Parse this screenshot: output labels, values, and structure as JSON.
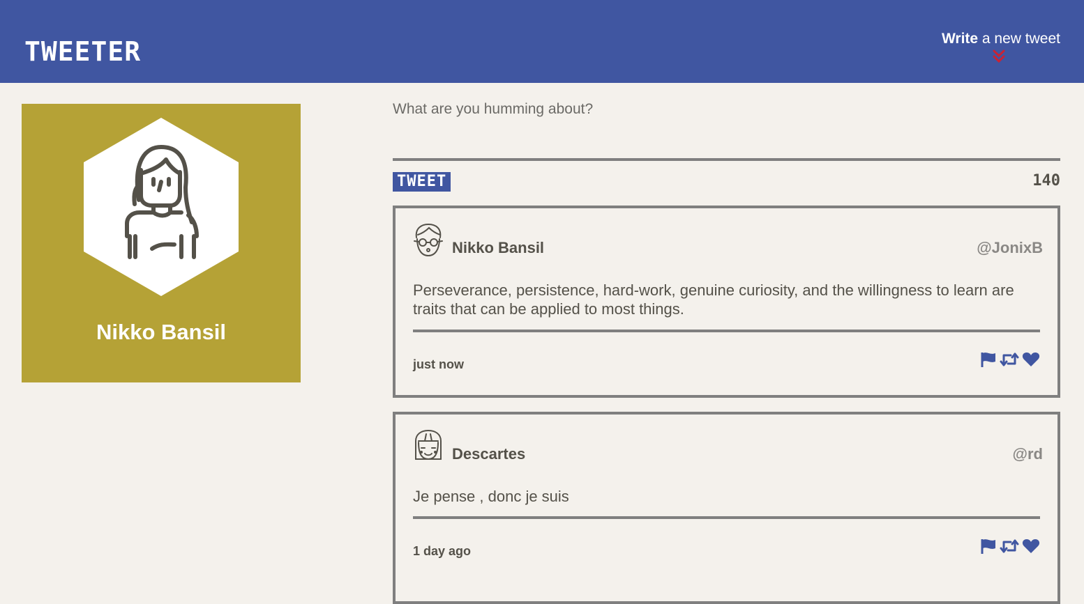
{
  "nav": {
    "brand": "TWEETER",
    "compose_strong": "Write",
    "compose_rest": "a new tweet"
  },
  "colors": {
    "nav": "#4056a1",
    "profile_bg": "#b5a236",
    "arrow": "#cc2233",
    "page_bg": "#f4f1ec",
    "border": "#7f7f7f"
  },
  "profile": {
    "name": "Nikko Bansil"
  },
  "compose": {
    "placeholder": "What are you humming about?",
    "button_label": "TWEET",
    "counter": "140"
  },
  "tweets": [
    {
      "avatar_icon": "glasses-face-icon",
      "name": "Nikko Bansil",
      "handle": "@JonixB",
      "text": "Perseverance, persistence, hard-work, genuine curiosity, and the willingness to learn are traits that can be applied to most things.",
      "time": "just now"
    },
    {
      "avatar_icon": "smiling-face-icon",
      "name": "Descartes",
      "handle": "@rd",
      "text": "Je pense , donc je suis",
      "time": "1 day ago"
    }
  ],
  "actions": [
    "flag-icon",
    "retweet-icon",
    "heart-icon"
  ]
}
